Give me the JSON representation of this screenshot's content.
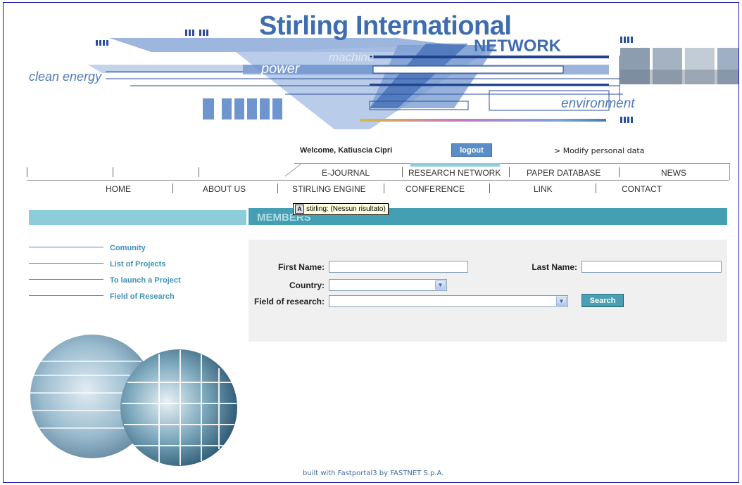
{
  "banner": {
    "title": "Stirling International",
    "network": "NETWORK",
    "clean_energy": "clean energy",
    "power": "power",
    "machine": "machine",
    "environment": "environment"
  },
  "user": {
    "welcome": "Welcome, Katiuscia Cipri",
    "logout": "logout",
    "modify": "> Modify personal data"
  },
  "nav_top": [
    "E-JOURNAL",
    "RESEARCH NETWORK",
    "PAPER DATABASE",
    "NEWS"
  ],
  "nav_main": [
    "HOME",
    "ABOUT US",
    "STIRLING ENGINE",
    "CONFERENCE",
    "LINK",
    "CONTACT"
  ],
  "tooltip": "stirling: (Nessun risultato)",
  "section_title": "MEMBERS",
  "sidebar": {
    "links": [
      "Comunity",
      "List of Projects",
      "To launch a Project",
      "Field of Research"
    ]
  },
  "form": {
    "first_name_label": "First Name:",
    "first_name_value": "",
    "last_name_label": "Last Name:",
    "last_name_value": "",
    "country_label": "Country:",
    "country_value": "",
    "field_label": "Field of research:",
    "field_value": "",
    "search_button": "Search"
  },
  "footer": "built with Fastportal3 by FASTNET S.p.A."
}
